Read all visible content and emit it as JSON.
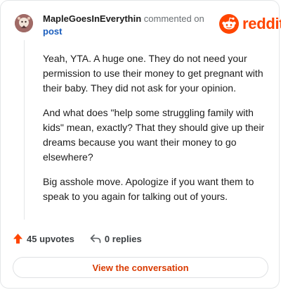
{
  "header": {
    "username": "MapleGoesInEverythin",
    "action_text": " commented on",
    "post_link": "post"
  },
  "brand": {
    "name": "reddit",
    "color": "#ff4500",
    "icon": "reddit-snoo-icon"
  },
  "comment": {
    "paragraphs": [
      "Yeah, YTA. A huge one. They do not need your permission to use their money to get pregnant with their baby. They did not ask for your opinion.",
      "And what does \"help some struggling family with kids\" mean, exactly? That they should give up their dreams because you want their money to go elsewhere?",
      "Big asshole move. Apologize if you want them to speak to you again for talking out of yours."
    ]
  },
  "actions": {
    "upvotes": "45 upvotes",
    "upvote_icon": "upvote-arrow-icon",
    "upvote_color": "#ff4500",
    "replies": "0 replies",
    "reply_icon": "reply-arrow-icon"
  },
  "view_button": {
    "label": "View the conversation",
    "color": "#d93a00"
  }
}
